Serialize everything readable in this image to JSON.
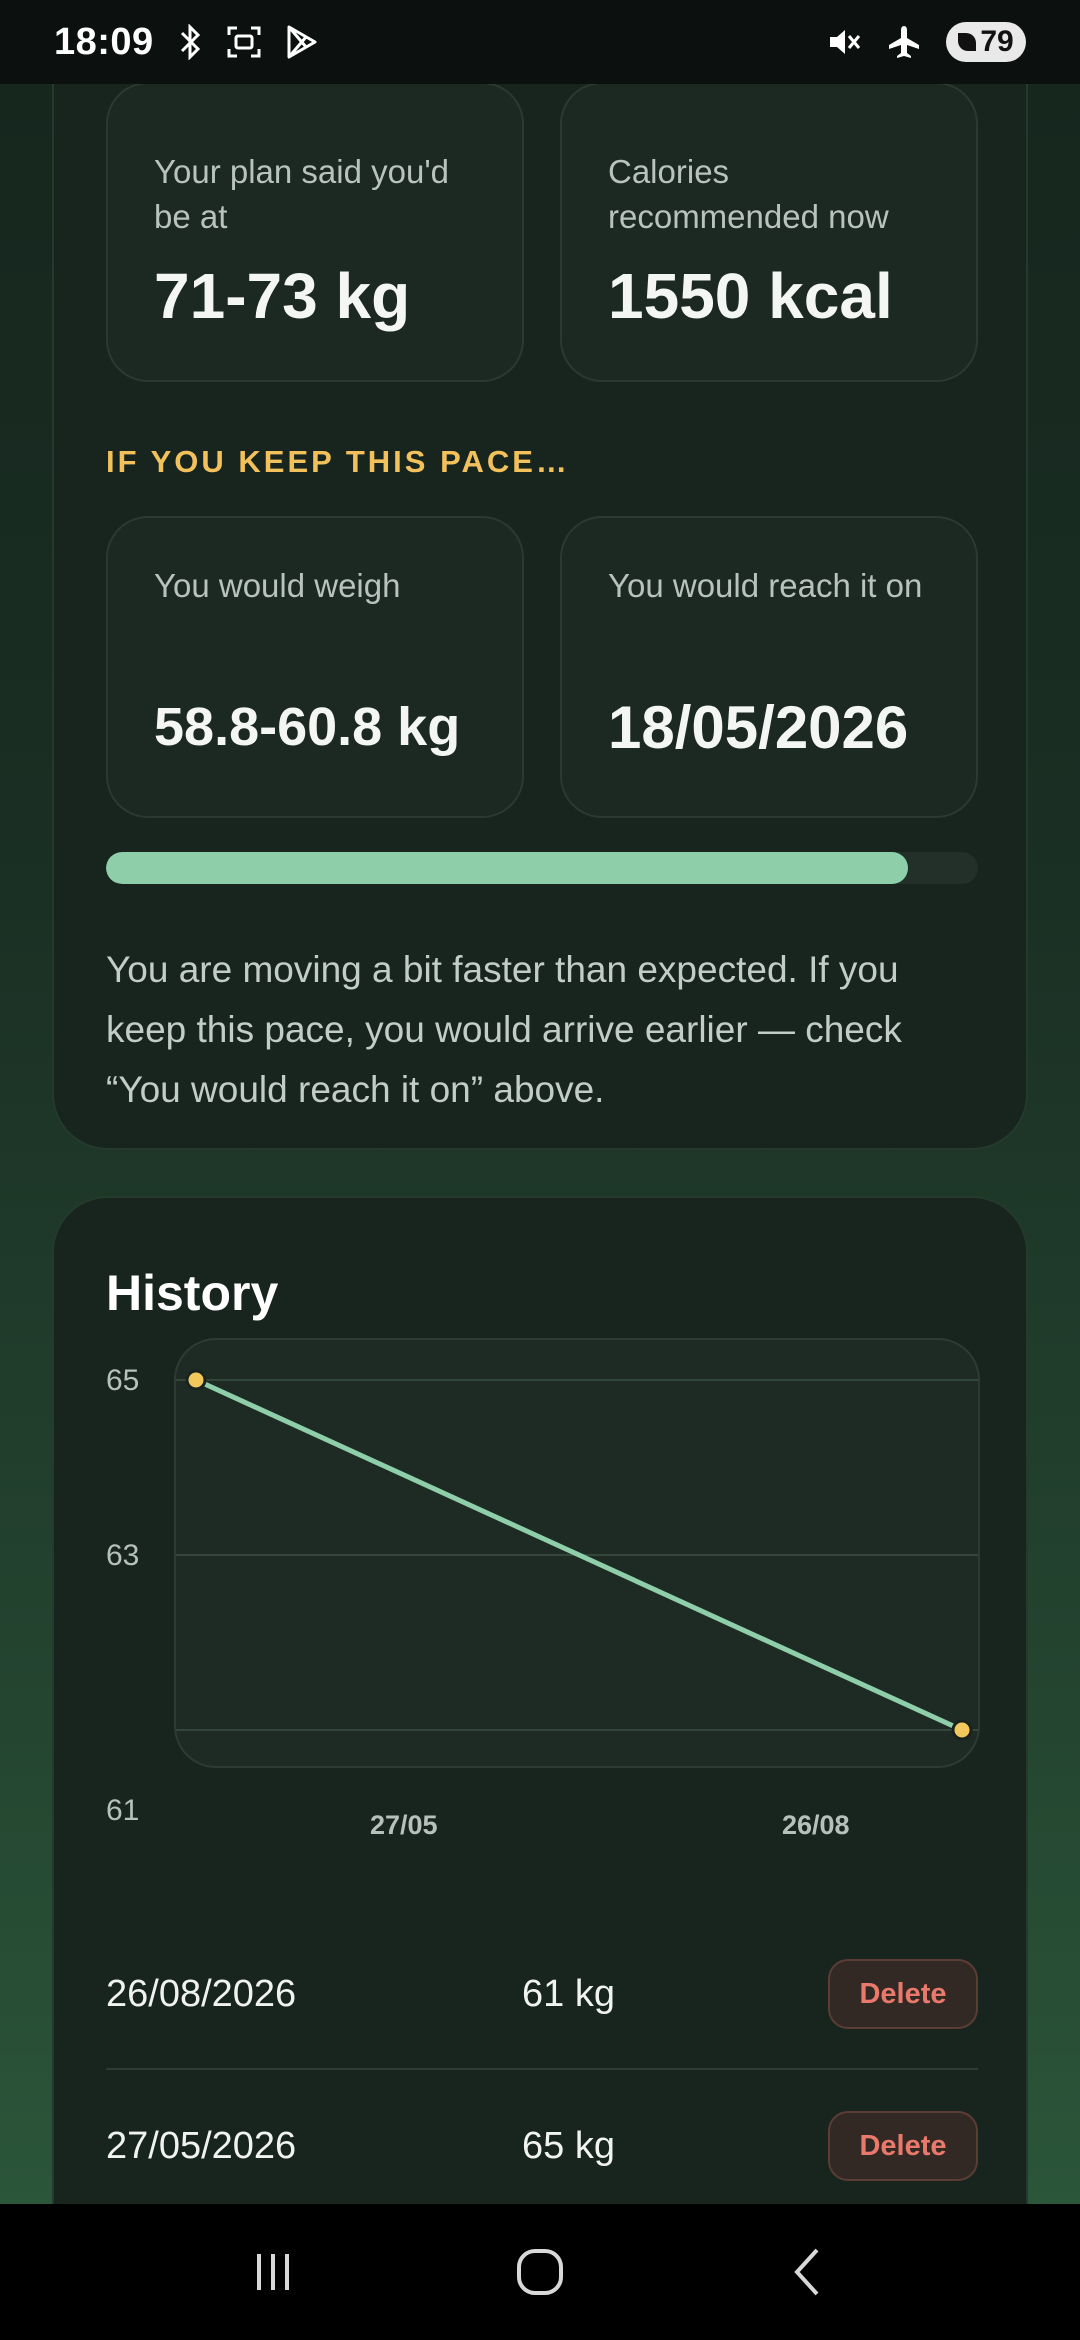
{
  "status_bar": {
    "time": "18:09",
    "left_icons": [
      "bluetooth-icon",
      "screenshot-icon",
      "play-store-icon"
    ],
    "right_icons": [
      "mute-icon",
      "airplane-mode-icon"
    ],
    "battery_level": "79"
  },
  "current_plan": {
    "plan_label": "Your plan said you'd be at",
    "plan_value": "71-73 kg",
    "calories_label": "Calories recommended now",
    "calories_value": "1550 kcal"
  },
  "projection": {
    "kicker": "IF YOU KEEP THIS PACE…",
    "weigh_label": "You would weigh",
    "weigh_value": "58.8-60.8 kg",
    "reach_label": "You would reach it on",
    "reach_value": "18/05/2026",
    "progress": 0.92,
    "note": "You are moving a bit faster than expected. If you keep this pace, you would arrive earlier — check “You would reach it on” above."
  },
  "history": {
    "title": "History",
    "entries": [
      {
        "date": "26/08/2026",
        "weight": "61 kg",
        "delete_label": "Delete"
      },
      {
        "date": "27/05/2026",
        "weight": "65 kg",
        "delete_label": "Delete"
      }
    ]
  },
  "chart_data": {
    "type": "line",
    "title": "History",
    "xlabel": "",
    "ylabel": "",
    "x_tick_labels": [
      "27/05",
      "26/08"
    ],
    "y_tick_labels": [
      "65",
      "63",
      "61"
    ],
    "ylim": [
      61,
      65
    ],
    "grid": true,
    "series": [
      {
        "points": [
          {
            "x": "27/05/2026",
            "y": 65
          },
          {
            "x": "26/08/2026",
            "y": 61
          }
        ]
      }
    ],
    "colors": {
      "line": "#8ecfa9",
      "point": "#f2c75c"
    }
  },
  "nav_bar": {
    "icons": [
      "recent-apps-icon",
      "home-icon",
      "back-icon"
    ]
  }
}
